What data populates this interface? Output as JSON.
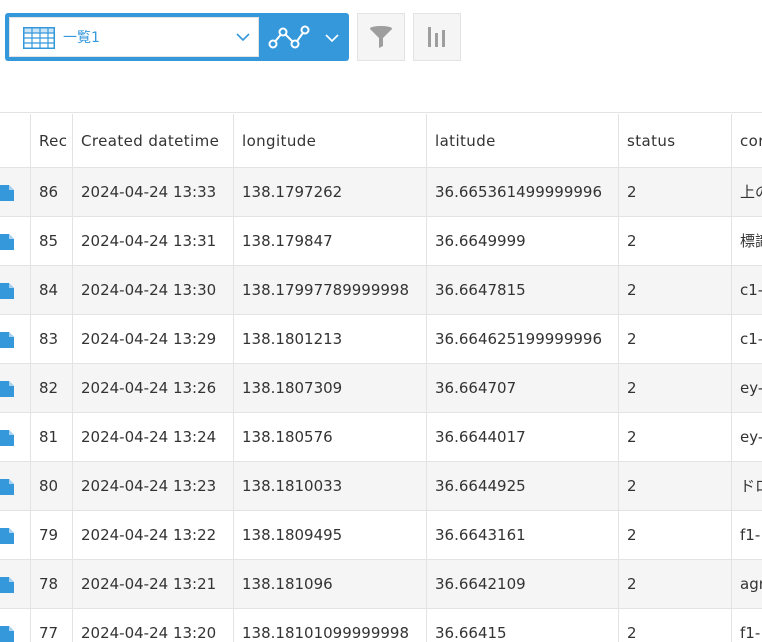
{
  "toolbar": {
    "view_select": {
      "label": "一覧1",
      "icon": "table-icon",
      "chevron": "chevron-down-icon"
    },
    "graph_button": {
      "icon": "line-graph-icon",
      "chevron": "chevron-down-icon"
    },
    "filter_button": {
      "icon": "filter-funnel-icon"
    },
    "graph_settings_button": {
      "icon": "bar-chart-icon"
    }
  },
  "colors": {
    "accent": "#3498db",
    "row_alt": "#f5f5f5",
    "border": "#e3e3e3",
    "icon_gray": "#9e9e9e"
  },
  "table": {
    "columns": [
      "Rec",
      "Created datetime",
      "longitude",
      "latitude",
      "status",
      "cor"
    ],
    "row_icon": "document-icon",
    "rows": [
      {
        "record": "86",
        "created": "2024-04-24 13:33",
        "longitude": "138.1797262",
        "latitude": "36.665361499999996",
        "status": "2",
        "comment": "上の"
      },
      {
        "record": "85",
        "created": "2024-04-24 13:31",
        "longitude": "138.179847",
        "latitude": "36.6649999",
        "status": "2",
        "comment": "標識"
      },
      {
        "record": "84",
        "created": "2024-04-24 13:30",
        "longitude": "138.17997789999998",
        "latitude": "36.6647815",
        "status": "2",
        "comment": "c1-"
      },
      {
        "record": "83",
        "created": "2024-04-24 13:29",
        "longitude": "138.1801213",
        "latitude": "36.664625199999996",
        "status": "2",
        "comment": "c1-"
      },
      {
        "record": "82",
        "created": "2024-04-24 13:26",
        "longitude": "138.1807309",
        "latitude": "36.664707",
        "status": "2",
        "comment": "ey-"
      },
      {
        "record": "81",
        "created": "2024-04-24 13:24",
        "longitude": "138.180576",
        "latitude": "36.6644017",
        "status": "2",
        "comment": "ey-"
      },
      {
        "record": "80",
        "created": "2024-04-24 13:23",
        "longitude": "138.1810033",
        "latitude": "36.6644925",
        "status": "2",
        "comment": "ドロ"
      },
      {
        "record": "79",
        "created": "2024-04-24 13:22",
        "longitude": "138.1809495",
        "latitude": "36.6643161",
        "status": "2",
        "comment": "f1-"
      },
      {
        "record": "78",
        "created": "2024-04-24 13:21",
        "longitude": "138.181096",
        "latitude": "36.6642109",
        "status": "2",
        "comment": "agr"
      },
      {
        "record": "77",
        "created": "2024-04-24 13:20",
        "longitude": "138.18101099999998",
        "latitude": "36.66415",
        "status": "2",
        "comment": "f1-"
      }
    ]
  }
}
